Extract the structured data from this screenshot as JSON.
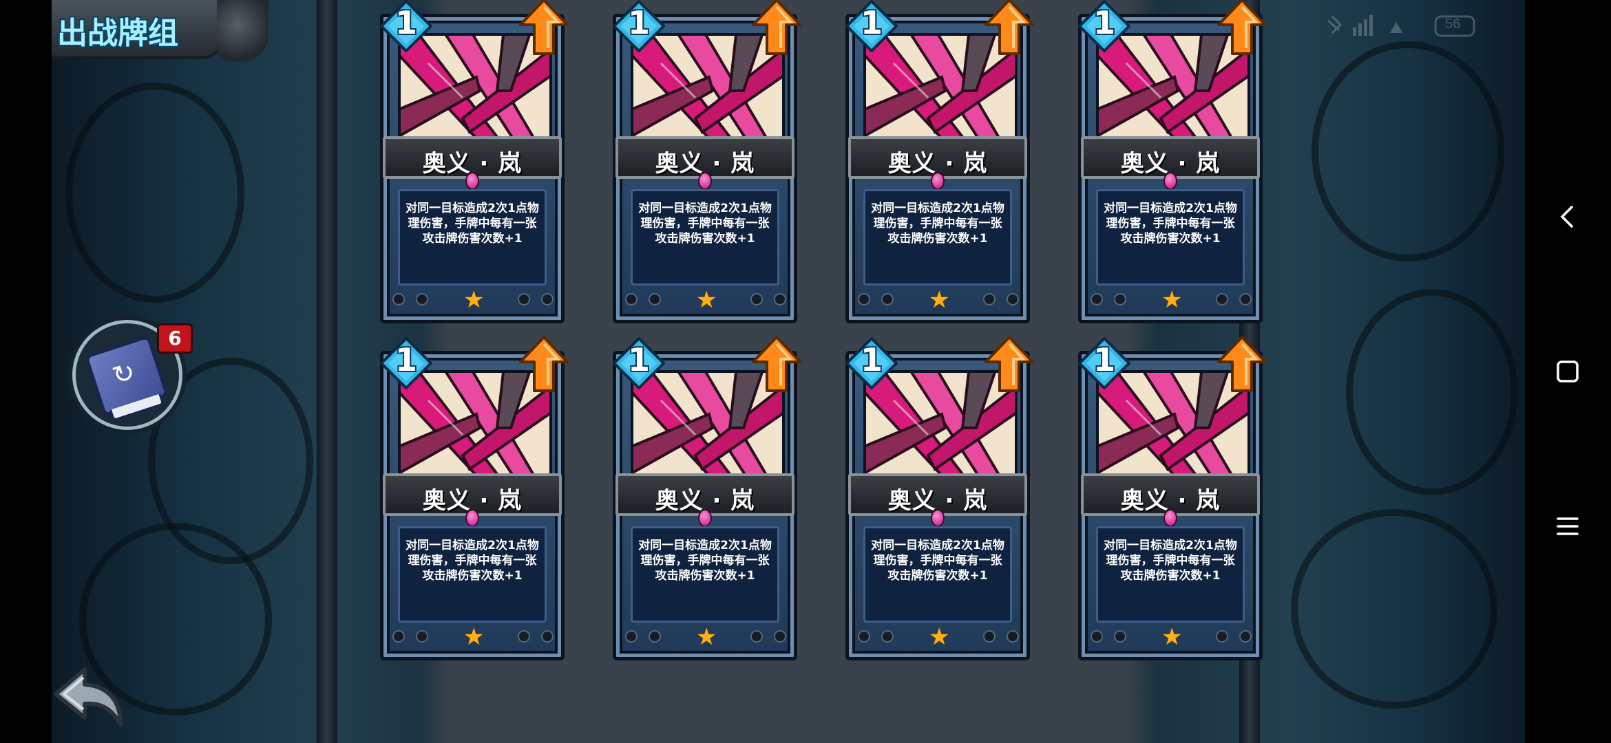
{
  "title": "出战牌组",
  "deck": {
    "count": "6",
    "icon": "deck-book-icon"
  },
  "status": {
    "battery": "56"
  },
  "colors": {
    "cost_gem": "#2fb8e8",
    "upgrade_arrow": "#ff8a1a",
    "card_frame": "#1f3a58",
    "art_pink": "#d81b7a",
    "star": "#ffb015",
    "badge_red": "#c3131b",
    "title_text": "#a9f0ff"
  },
  "cards": [
    {
      "cost": "1",
      "name": "奥义 · 岚",
      "desc": "对同一目标造成2次1点物理伤害，手牌中每有一张攻击牌伤害次数+1",
      "stars": 1
    },
    {
      "cost": "1",
      "name": "奥义 · 岚",
      "desc": "对同一目标造成2次1点物理伤害，手牌中每有一张攻击牌伤害次数+1",
      "stars": 1
    },
    {
      "cost": "1",
      "name": "奥义 · 岚",
      "desc": "对同一目标造成2次1点物理伤害，手牌中每有一张攻击牌伤害次数+1",
      "stars": 1
    },
    {
      "cost": "1",
      "name": "奥义 · 岚",
      "desc": "对同一目标造成2次1点物理伤害，手牌中每有一张攻击牌伤害次数+1",
      "stars": 1
    },
    {
      "cost": "1",
      "name": "奥义 · 岚",
      "desc": "对同一目标造成2次1点物理伤害，手牌中每有一张攻击牌伤害次数+1",
      "stars": 1
    },
    {
      "cost": "1",
      "name": "奥义 · 岚",
      "desc": "对同一目标造成2次1点物理伤害，手牌中每有一张攻击牌伤害次数+1",
      "stars": 1
    },
    {
      "cost": "1",
      "name": "奥义 · 岚",
      "desc": "对同一目标造成2次1点物理伤害，手牌中每有一张攻击牌伤害次数+1",
      "stars": 1
    },
    {
      "cost": "1",
      "name": "奥义 · 岚",
      "desc": "对同一目标造成2次1点物理伤害，手牌中每有一张攻击牌伤害次数+1",
      "stars": 1
    }
  ],
  "nav": {
    "back": "chevron-left-icon",
    "home": "square-icon",
    "menu": "hamburger-icon"
  }
}
